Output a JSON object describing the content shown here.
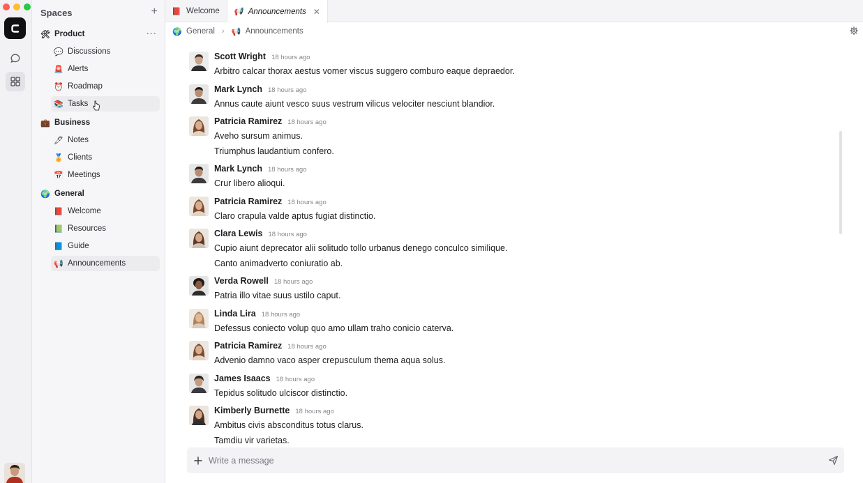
{
  "sidebar": {
    "title": "Spaces",
    "add_label": "+",
    "groups": [
      {
        "label": "Product",
        "icon": "hammer-wrench-icon",
        "more": "···",
        "items": [
          {
            "label": "Discussions",
            "icon": "speech-bubble-icon"
          },
          {
            "label": "Alerts",
            "icon": "siren-icon"
          },
          {
            "label": "Roadmap",
            "icon": "alarm-clock-icon"
          },
          {
            "label": "Tasks",
            "icon": "books-icon"
          }
        ]
      },
      {
        "label": "Business",
        "icon": "briefcase-icon",
        "items": [
          {
            "label": "Notes",
            "icon": "pen-icon"
          },
          {
            "label": "Clients",
            "icon": "medal-icon"
          },
          {
            "label": "Meetings",
            "icon": "calendar-icon"
          }
        ]
      },
      {
        "label": "General",
        "icon": "globe-icon",
        "items": [
          {
            "label": "Welcome",
            "icon": "red-book-icon"
          },
          {
            "label": "Resources",
            "icon": "green-book-icon"
          },
          {
            "label": "Guide",
            "icon": "blue-book-icon"
          },
          {
            "label": "Announcements",
            "icon": "megaphone-icon"
          }
        ]
      }
    ]
  },
  "tabs": [
    {
      "label": "Welcome",
      "icon": "red-book-icon",
      "active": false
    },
    {
      "label": "Announcements",
      "icon": "megaphone-icon",
      "active": true,
      "close": "✕"
    }
  ],
  "breadcrumb": {
    "parent": "General",
    "current": "Announcements",
    "separator": "›"
  },
  "messages": [
    {
      "author": "Scott Wright",
      "time": "18 hours ago",
      "lines": [
        "Arbitro calcar thorax aestus vomer viscus suggero comburo eaque depraedor."
      ]
    },
    {
      "author": "Mark Lynch",
      "time": "18 hours ago",
      "lines": [
        "Annus caute aiunt vesco suus vestrum vilicus velociter nesciunt blandior."
      ]
    },
    {
      "author": "Patricia Ramirez",
      "time": "18 hours ago",
      "lines": [
        "Aveho sursum animus.",
        "Triumphus laudantium confero."
      ]
    },
    {
      "author": "Mark Lynch",
      "time": "18 hours ago",
      "lines": [
        "Crur libero alioqui."
      ]
    },
    {
      "author": "Patricia Ramirez",
      "time": "18 hours ago",
      "lines": [
        "Claro crapula valde aptus fugiat distinctio."
      ]
    },
    {
      "author": "Clara Lewis",
      "time": "18 hours ago",
      "lines": [
        "Cupio aiunt deprecator alii solitudo tollo urbanus denego conculco similique.",
        "Canto animadverto coniuratio ab."
      ]
    },
    {
      "author": "Verda Rowell",
      "time": "18 hours ago",
      "lines": [
        "Patria illo vitae suus ustilo caput."
      ]
    },
    {
      "author": "Linda Lira",
      "time": "18 hours ago",
      "lines": [
        "Defessus coniecto volup quo amo ullam traho conicio caterva."
      ]
    },
    {
      "author": "Patricia Ramirez",
      "time": "18 hours ago",
      "lines": [
        "Advenio damno vaco asper crepusculum thema aqua solus."
      ]
    },
    {
      "author": "James Isaacs",
      "time": "18 hours ago",
      "lines": [
        "Tepidus solitudo ulciscor distinctio."
      ]
    },
    {
      "author": "Kimberly Burnette",
      "time": "18 hours ago",
      "lines": [
        "Ambitus civis absconditus totus clarus.",
        "Tamdiu vir varietas."
      ]
    }
  ],
  "composer": {
    "placeholder": "Write a message"
  },
  "colors": {
    "accent": "#111111",
    "selected_bg": "#ececef",
    "sidebar_bg": "#f6f6f8"
  }
}
